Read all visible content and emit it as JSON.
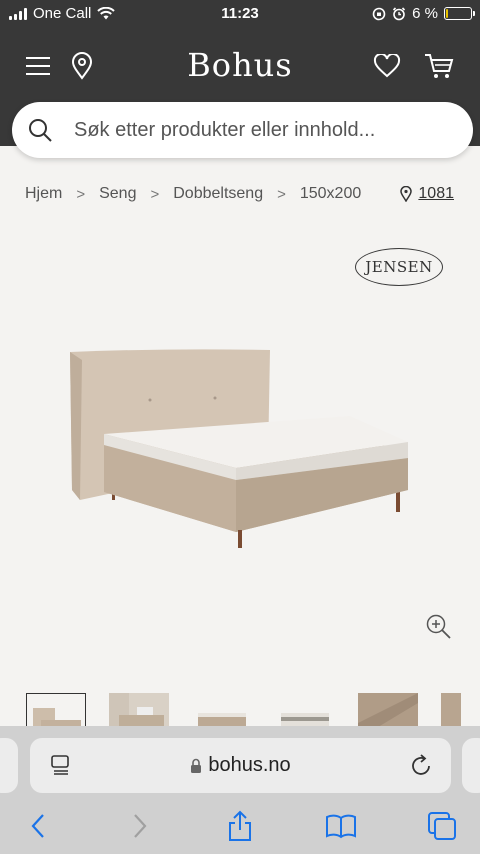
{
  "status_bar": {
    "carrier": "One Call",
    "time": "11:23",
    "battery": "6 %",
    "battery_level": 0.06
  },
  "header": {
    "brand": "Bohus",
    "icons": [
      "menu-icon",
      "location-pin-icon",
      "heart-icon",
      "cart-icon"
    ]
  },
  "search": {
    "placeholder": "Søk etter produkter eller innhold..."
  },
  "breadcrumb": [
    "Hjem",
    "Seng",
    "Dobbeltseng",
    "150x200"
  ],
  "store": {
    "label": "1081"
  },
  "brand_logo": "JENSEN",
  "thumbnails_count": 6,
  "safari": {
    "url": "bohus.no"
  },
  "colors": {
    "header_bg": "#383838",
    "page_bg": "#f4f3f1",
    "safari_bg": "#d0d0d0",
    "ios_blue": "#1a73e8"
  }
}
